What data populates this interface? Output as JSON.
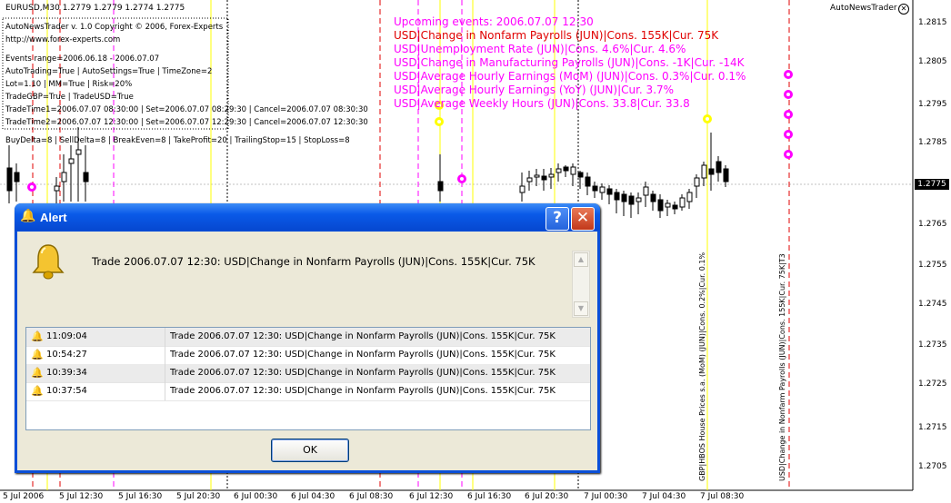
{
  "colors": {
    "red_line": "#e00000",
    "magenta": "#ff00ff",
    "yellow": "#ffff00",
    "grid": "#c0c0c0"
  },
  "header": {
    "symbol_line": "EURUSD,M30  1.2779 1.2779 1.2774 1.2775"
  },
  "ea_label": "AutoNewsTrader",
  "ea_close_icon": "close-circle-icon",
  "current_price": "1.2775",
  "price_axis": [
    "1.2815",
    "1.2805",
    "1.2795",
    "1.2785",
    "1.2765",
    "1.2755",
    "1.2745",
    "1.2735",
    "1.2725",
    "1.2715",
    "1.2705"
  ],
  "time_axis": [
    "5 Jul 2006",
    "5 Jul 12:30",
    "5 Jul 16:30",
    "5 Jul 20:30",
    "6 Jul 00:30",
    "6 Jul 04:30",
    "6 Jul 08:30",
    "6 Jul 12:30",
    "6 Jul 16:30",
    "6 Jul 20:30",
    "7 Jul 00:30",
    "7 Jul 04:30",
    "7 Jul 08:30"
  ],
  "info_lines": [
    "AutoNewsTrader v. 1.0 Copyright © 2006, Forex-Experts",
    "http://www.forex-experts.com",
    "Events range=2006.06.18 - 2006.07.07",
    "AutoTrading=True | AutoSettings=True | TimeZone=2",
    "Lot=1.10 | MM=True | Risk=20%",
    "TradeGBP=True | TradeUSD=True",
    "TradeTime1=2006.07.07 08:30:00 | Set=2006.07.07 08:29:30 | Cancel=2006.07.07 08:30:30",
    "TradeTime2=2006.07.07 12:30:00 | Set=2006.07.07 12:29:30 | Cancel=2006.07.07 12:30:30",
    "BuyDelta=8 | SellDelta=8 | BreakEven=8 | TakeProfit=20 | TrailingStop=15 | StopLoss=8"
  ],
  "upcoming_events": [
    {
      "text": "Upcoming events: 2006.07.07 12:30",
      "color": "#ff00ff"
    },
    {
      "text": "USD|Change in Nonfarm Payrolls (JUN)|Cons. 155K|Cur. 75K",
      "color": "#e00000"
    },
    {
      "text": "USD|Unemployment Rate (JUN)|Cons. 4.6%|Cur. 4.6%",
      "color": "#ff00ff"
    },
    {
      "text": "USD|Change in Manufacturing Payrolls (JUN)|Cons. -1K|Cur. -14K",
      "color": "#ff00ff"
    },
    {
      "text": "USD|Average Hourly Earnings (MoM) (JUN)|Cons. 0.3%|Cur. 0.1%",
      "color": "#ff00ff"
    },
    {
      "text": "USD|Average Hourly Earnings (YoY) (JUN)|Cur. 3.7%",
      "color": "#ff00ff"
    },
    {
      "text": "USD|Average Weekly Hours (JUN)|Cons. 33.8|Cur. 33.8",
      "color": "#ff00ff"
    }
  ],
  "vertical_labels": [
    "GBP|HBOS House Prices s.a. (MoM) (JUN)|Cons. 0.2%|Cur. 0.1%",
    "USD|Change in Nonfarm Payrolls (JUN)|Cons. 155K|Cur. 75K|T3"
  ],
  "dialog": {
    "title": "Alert",
    "title_icon": "bell-icon",
    "help_label": "?",
    "close_label": "✕",
    "message": "Trade 2006.07.07 12:30: USD|Change in Nonfarm Payrolls (JUN)|Cons. 155K|Cur. 75K",
    "rows": [
      {
        "time": "11:09:04",
        "text": "Trade 2006.07.07 12:30: USD|Change in Nonfarm Payrolls (JUN)|Cons. 155K|Cur. 75K"
      },
      {
        "time": "10:54:27",
        "text": "Trade 2006.07.07 12:30: USD|Change in Nonfarm Payrolls (JUN)|Cons. 155K|Cur. 75K"
      },
      {
        "time": "10:39:34",
        "text": "Trade 2006.07.07 12:30: USD|Change in Nonfarm Payrolls (JUN)|Cons. 155K|Cur. 75K"
      },
      {
        "time": "10:37:54",
        "text": "Trade 2006.07.07 12:30: USD|Change in Nonfarm Payrolls (JUN)|Cons. 155K|Cur. 75K"
      }
    ],
    "ok_label": "OK"
  }
}
